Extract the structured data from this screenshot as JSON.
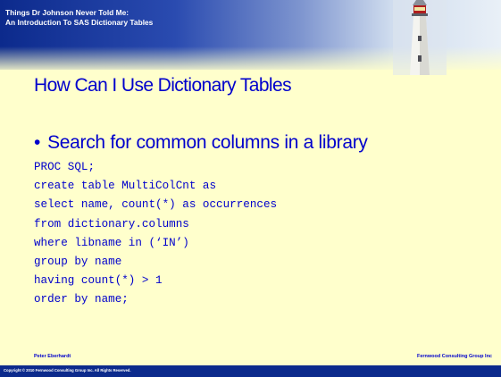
{
  "header": {
    "title_line1": "Things Dr Johnson Never Told Me:",
    "title_line2": "An Introduction To SAS Dictionary Tables",
    "logo": "lighthouse-image",
    "band_color": "#0c2a8c"
  },
  "slide": {
    "title": "How Can I Use Dictionary Tables",
    "bullet": "Search for common columns in a library",
    "bullet_marker": "•",
    "text_color": "#0000cc",
    "background_color": "#ffffcc"
  },
  "code": [
    "PROC SQL;",
    "create table MultiColCnt as",
    "select name, count(*) as occurrences",
    "from dictionary.columns",
    "where libname in (‘IN’)",
    "group by name",
    "having count(*) > 1",
    "order by name;"
  ],
  "footer": {
    "left": "Peter Eberhardt",
    "right": "Fernwood Consulting Group Inc",
    "copyright": "Copyright © 2010 Fernwood Consulting Group Inc. All Rights Reserved."
  }
}
